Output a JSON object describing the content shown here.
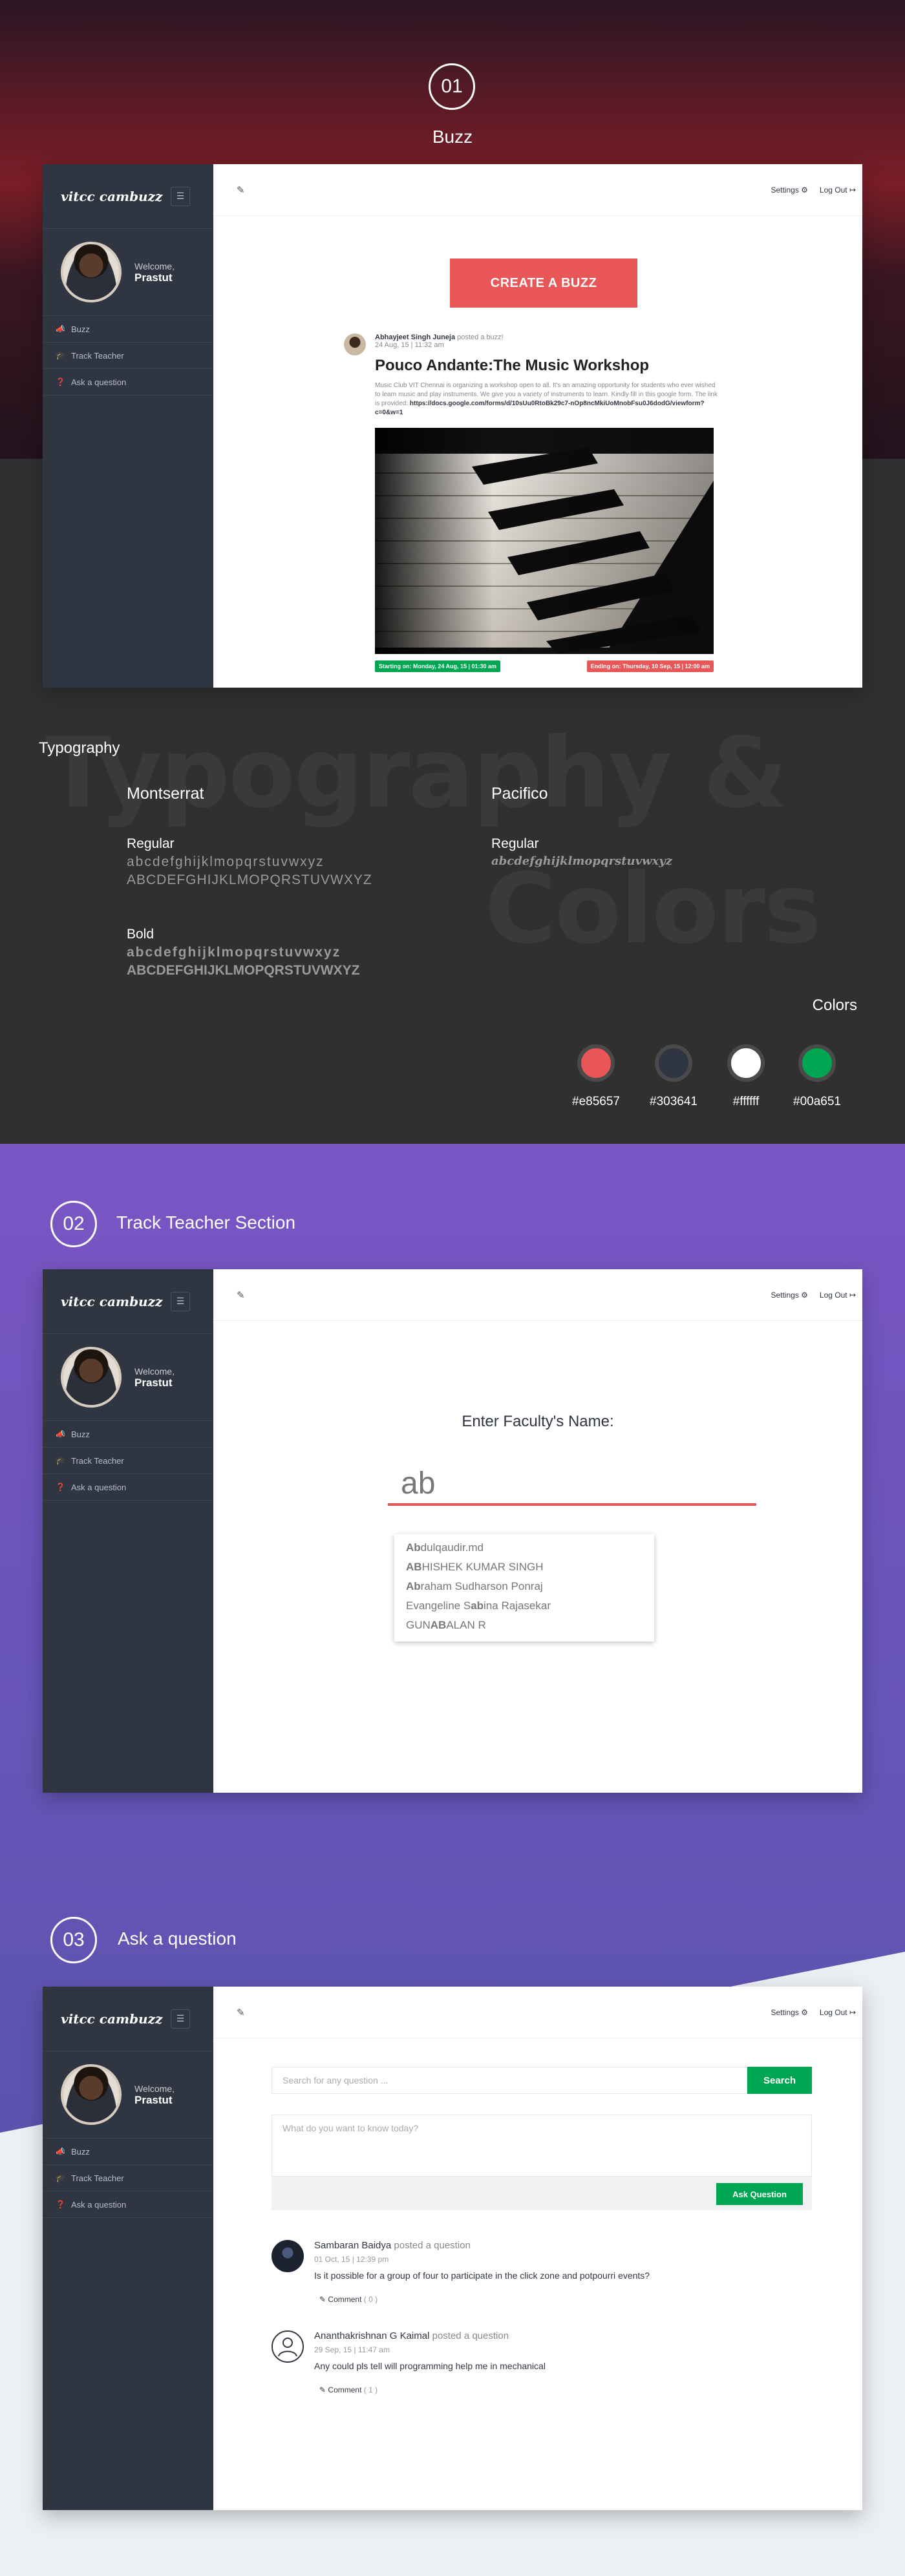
{
  "sections": {
    "buzz": {
      "number": "01",
      "title": "Buzz"
    },
    "track": {
      "number": "02",
      "title": "Track Teacher Section"
    },
    "ask": {
      "number": "03",
      "title": "Ask a question"
    }
  },
  "app": {
    "logo": "vitcc cambuzz",
    "welcome": "Welcome,",
    "user_name": "Prastut",
    "nav": [
      {
        "label": "Buzz",
        "icon": "megaphone-icon"
      },
      {
        "label": "Track Teacher",
        "icon": "graduation-cap-icon"
      },
      {
        "label": "Ask a question",
        "icon": "question-icon"
      }
    ],
    "settings_label": "Settings",
    "logout_label": "Log Out"
  },
  "buzz": {
    "create_label": "CREATE A BUZZ",
    "post": {
      "author": "Abhayjeet Singh Juneja",
      "action": "posted a buzz!",
      "date": "24 Aug, 15 | 11:32 am",
      "title": "Pouco Andante:The Music Workshop",
      "body": "Music Club VIT Chennai is organizing a workshop open to all. It's an amazing opportunity for students who ever wished to learn music and play instruments. We give you a variety of instruments to learn. Kindly fill in this google form. The link is provided:",
      "link": "https://docs.google.com/forms/d/10sUu0RtoBk29c7-nOp8ncMkiUoMnobFsu0J6dodG/viewform?c=0&w=1",
      "start": "Starting on: Monday, 24 Aug, 15 | 01:30 am",
      "end": "Ending on: Thursday, 10 Sep, 15 | 12:00 am"
    }
  },
  "typography": {
    "heading": "Typography",
    "watermark_1": "Typography &",
    "watermark_2": "Colors",
    "font1": "Montserrat",
    "font2": "Pacifico",
    "regular_label": "Regular",
    "bold_label": "Bold",
    "lower": "abcdefghijklmopqrstuvwxyz",
    "upper": "ABCDEFGHIJKLMOPQRSTUVWXYZ",
    "colors_heading": "Colors",
    "colors": [
      {
        "hex": "#e85657"
      },
      {
        "hex": "#303641"
      },
      {
        "hex": "#ffffff"
      },
      {
        "hex": "#00a651"
      }
    ]
  },
  "track": {
    "prompt": "Enter Faculty's Name:",
    "input_value": "ab",
    "suggestions": [
      {
        "match": "Ab",
        "rest": "dulqaudir.md"
      },
      {
        "match": "AB",
        "rest": "HISHEK KUMAR SINGH"
      },
      {
        "match": "Ab",
        "rest": "raham Sudharson Ponraj"
      },
      {
        "pre": "Evangeline S",
        "match": "ab",
        "rest": "ina Rajasekar"
      },
      {
        "pre": "GUN",
        "match": "AB",
        "rest": "ALAN R"
      }
    ]
  },
  "ask": {
    "search_placeholder": "Search for any question ...",
    "search_button": "Search",
    "question_placeholder": "What do you want to know today?",
    "ask_button": "Ask Question",
    "questions": [
      {
        "author": "Sambaran Baidya",
        "action": "posted a question",
        "date": "01 Oct, 15 | 12:39 pm",
        "text": "Is it possible for a group of four to participate in the click zone and potpourri events?",
        "comment_label": "Comment",
        "comment_count": "( 0 )"
      },
      {
        "author": "Ananthakrishnan G Kaimal",
        "action": "posted a question",
        "date": "29 Sep, 15 | 11:47 am",
        "text": "Any could pls tell will programming help me in mechanical",
        "comment_label": "Comment",
        "comment_count": "( 1 )"
      }
    ]
  }
}
